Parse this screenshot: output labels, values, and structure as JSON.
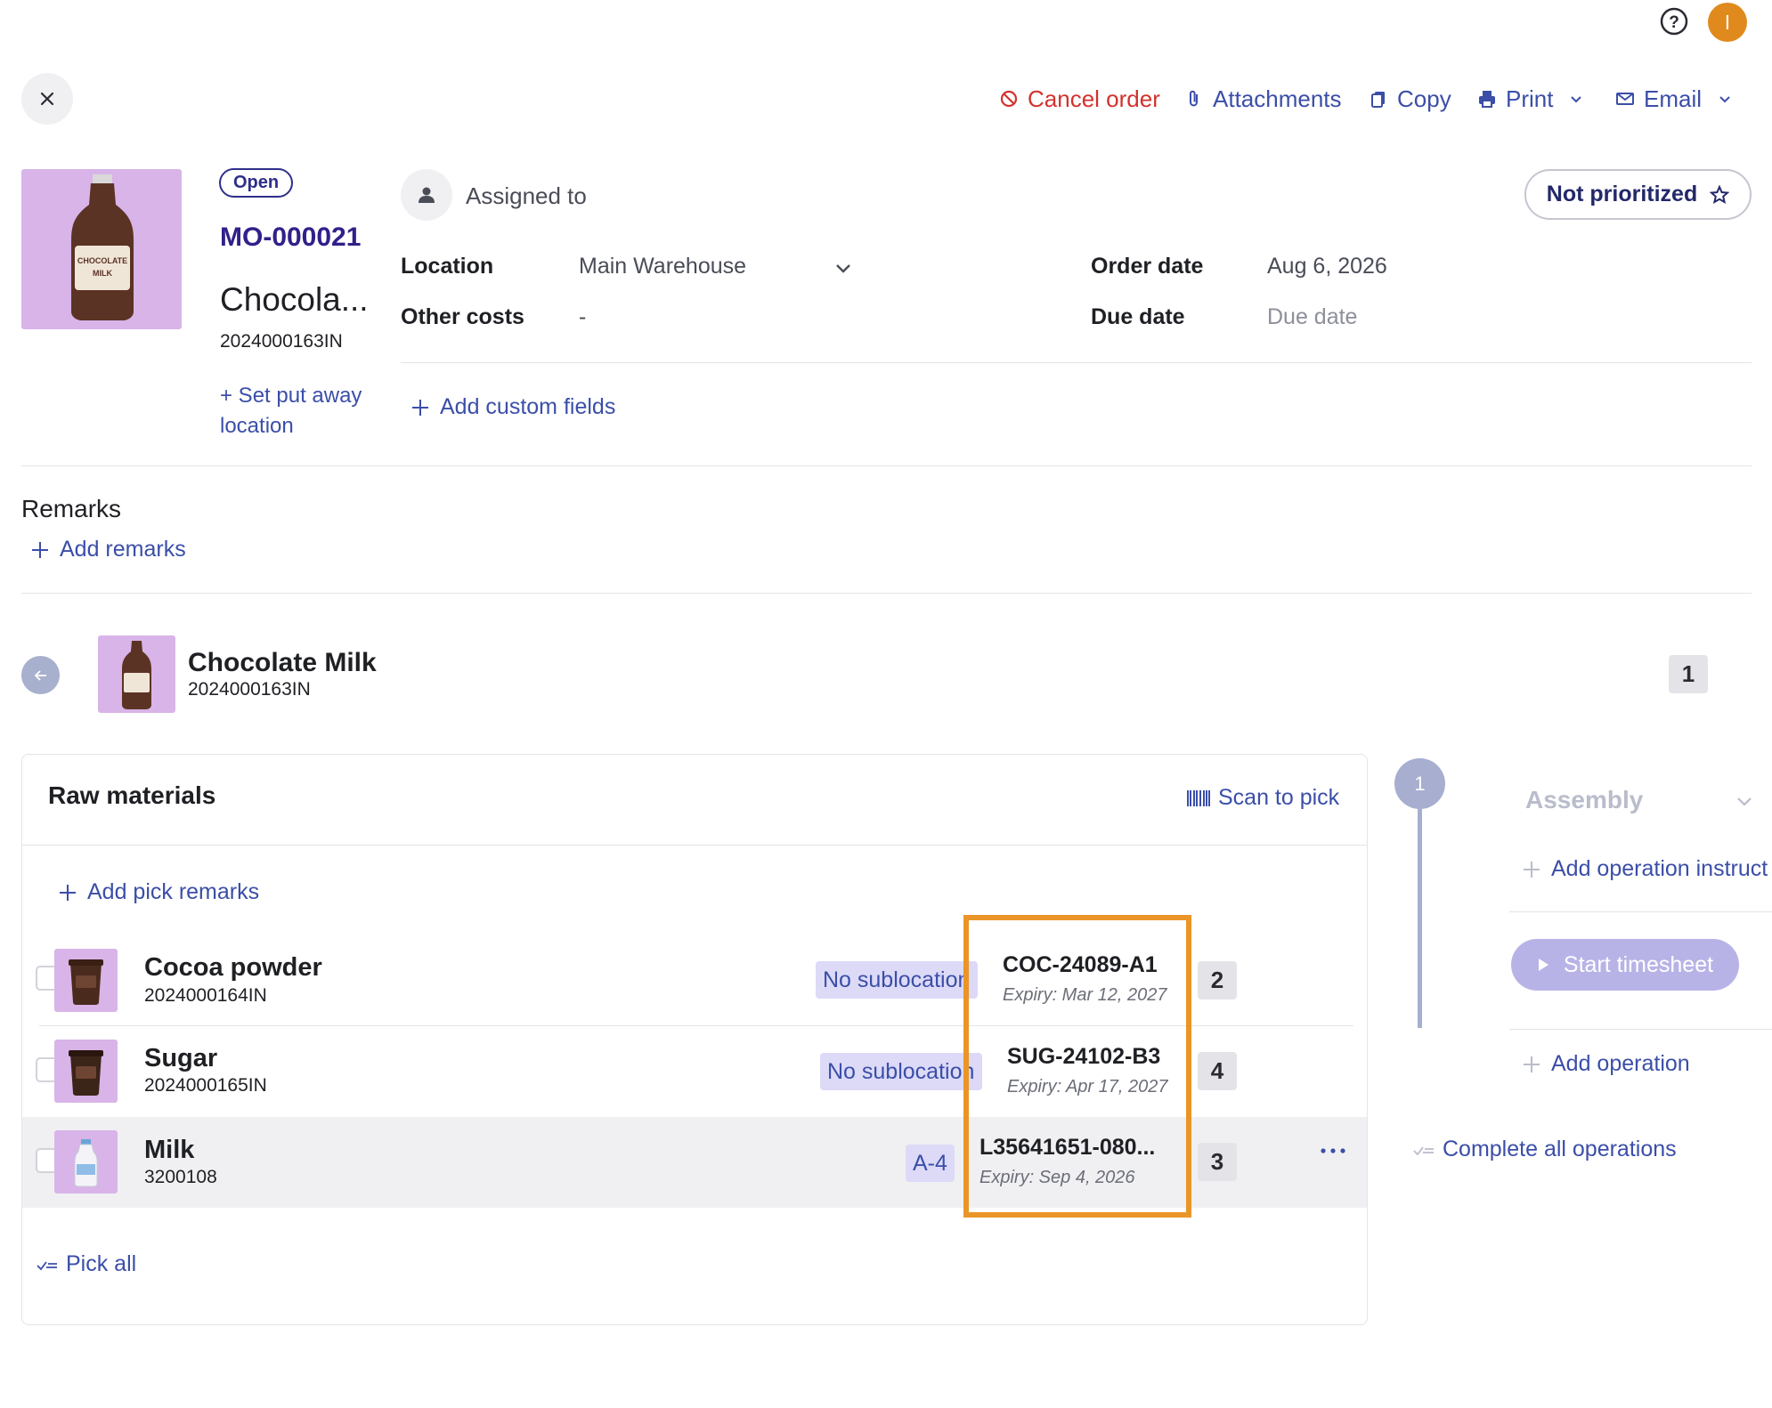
{
  "header": {
    "help_icon": "help-circle-icon",
    "avatar_initial": "I",
    "avatar_color": "#e08a1d"
  },
  "toolbar": {
    "cancel_order": "Cancel order",
    "attachments": "Attachments",
    "copy": "Copy",
    "print": "Print",
    "email": "Email"
  },
  "order": {
    "status": "Open",
    "number": "MO-000021",
    "product_name": "Chocola...",
    "product_code": "2024000163IN",
    "set_putaway": "+ Set put away location",
    "assigned_to": "Assigned to",
    "priority": "Not prioritized",
    "location_label": "Location",
    "location_value": "Main Warehouse",
    "other_costs_label": "Other costs",
    "other_costs_value": "-",
    "order_date_label": "Order date",
    "order_date_value": "Aug 6, 2026",
    "due_date_label": "Due date",
    "due_date_placeholder": "Due date",
    "add_custom_fields": "Add custom fields"
  },
  "remarks": {
    "title": "Remarks",
    "add": "Add remarks"
  },
  "product_header": {
    "name": "Chocolate Milk",
    "code": "2024000163IN",
    "quantity": "1"
  },
  "raw_materials": {
    "title": "Raw materials",
    "scan_to_pick": "Scan to pick",
    "add_pick_remarks": "Add pick remarks",
    "pick_all": "Pick all",
    "rows": [
      {
        "name": "Cocoa powder",
        "code": "2024000164IN",
        "sublocation": "No sublocation",
        "batch": "COC-24089-A1",
        "expiry": "Expiry: Mar 12, 2027",
        "quantity": "2"
      },
      {
        "name": "Sugar",
        "code": "2024000165IN",
        "sublocation": "No sublocation",
        "batch": "SUG-24102-B3",
        "expiry": "Expiry: Apr 17, 2027",
        "quantity": "4"
      },
      {
        "name": "Milk",
        "code": "3200108",
        "sublocation": "A-4",
        "batch": "L35641651-080...",
        "expiry": "Expiry: Sep 4, 2026",
        "quantity": "3"
      }
    ]
  },
  "operations": {
    "step": "1",
    "title": "Assembly",
    "add_instruction": "Add operation instruct",
    "start_timesheet": "Start timesheet",
    "add_operation": "Add operation",
    "complete_all": "Complete all operations"
  },
  "colors": {
    "link": "#3b4ea8",
    "danger": "#d2322d",
    "highlight": "#ea9527",
    "sublocation_bg": "#dcdaf7",
    "product_bg": "#d8b4e8"
  }
}
